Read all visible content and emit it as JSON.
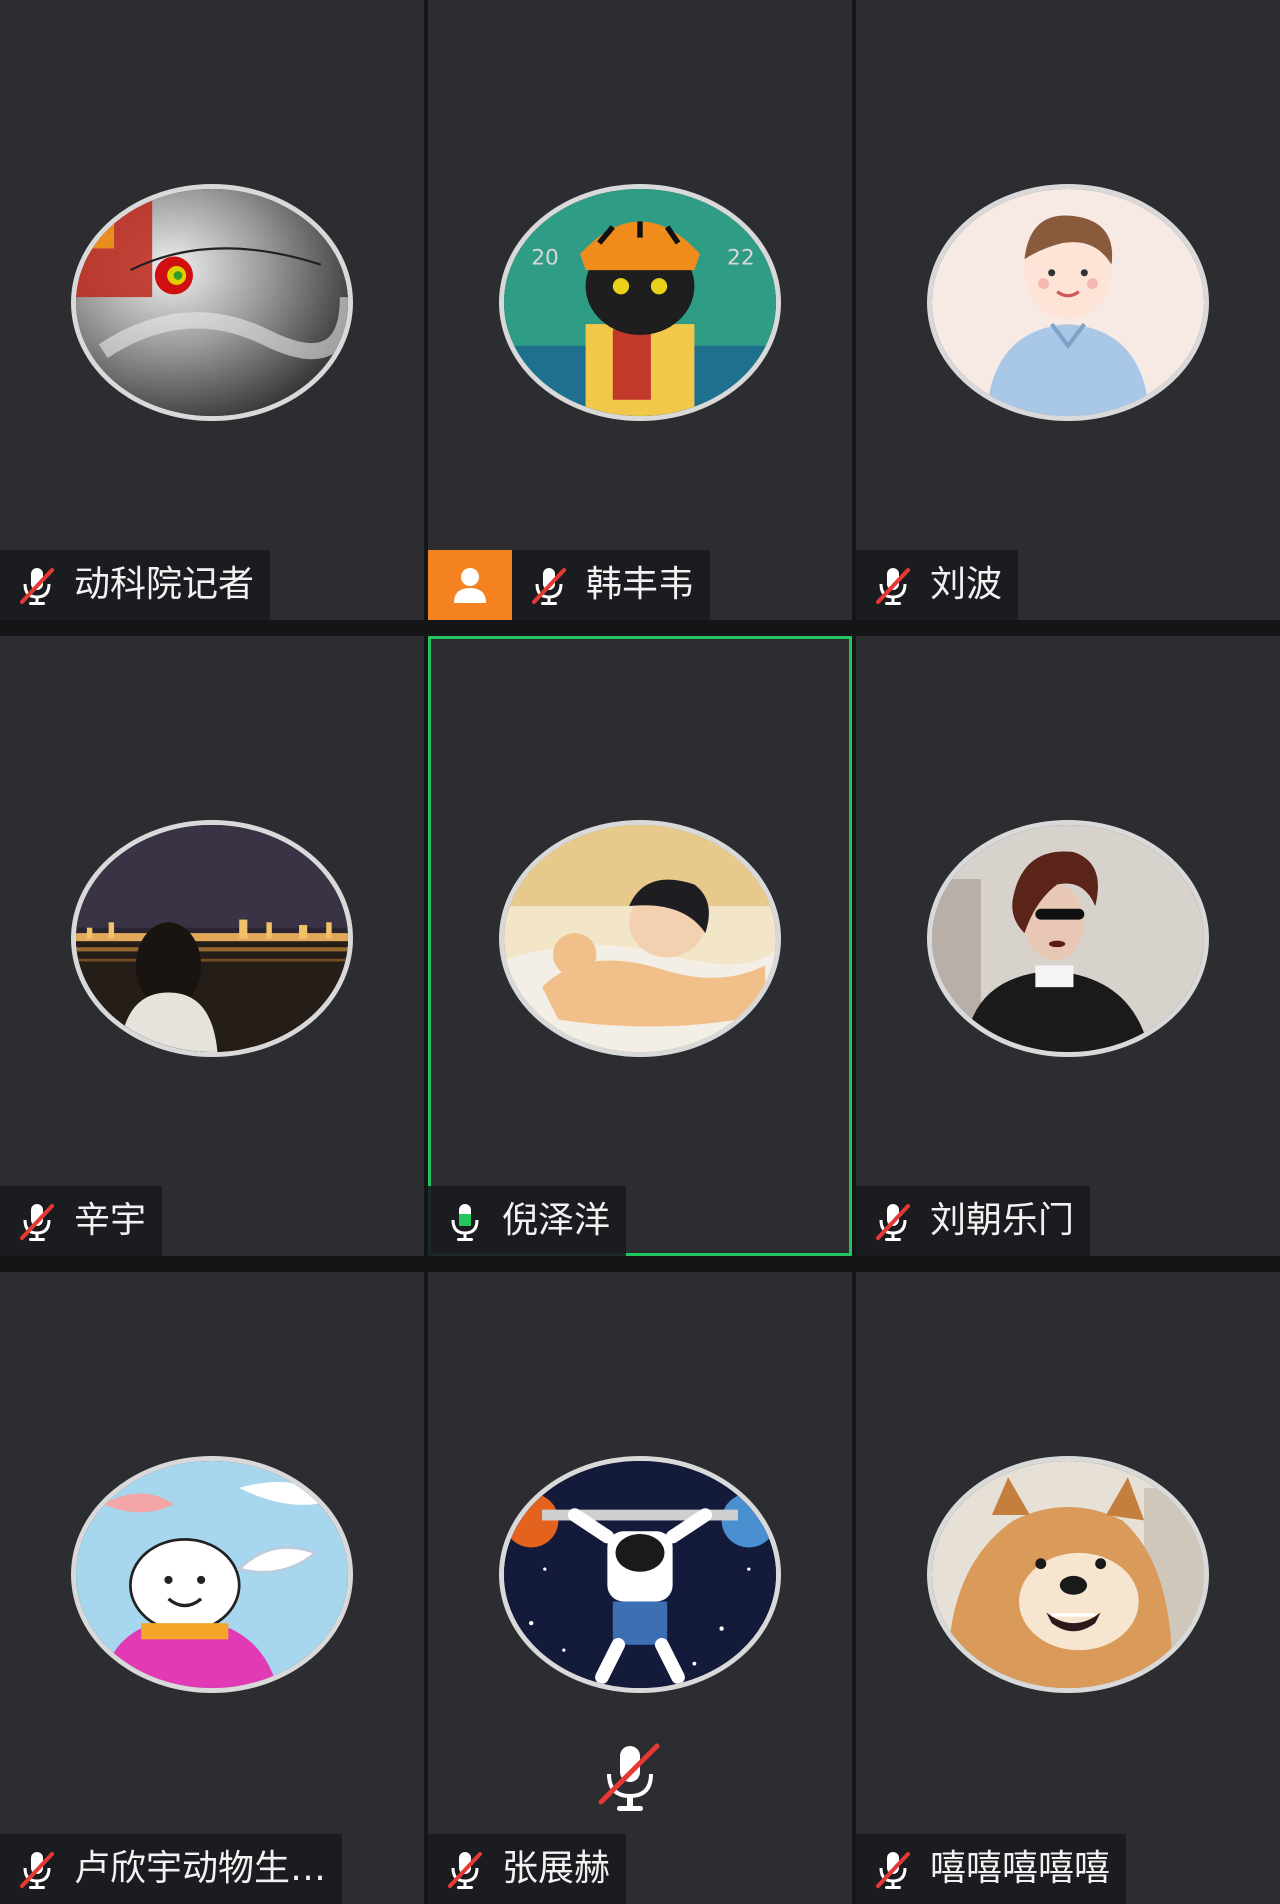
{
  "colors": {
    "tile_bg": "#2b2d31",
    "active_border": "#22c55e",
    "muted_slash": "#e53935",
    "speaking_mic": "#22c55e",
    "host_badge": "#f58220"
  },
  "participants": [
    {
      "name": "动科院记者",
      "mic": "muted",
      "host": false,
      "active": false,
      "avatar": "typhoon-satellite"
    },
    {
      "name": "韩丰韦",
      "mic": "muted",
      "host": true,
      "active": false,
      "avatar": "tiger-hat-cat"
    },
    {
      "name": "刘波",
      "mic": "muted",
      "host": false,
      "active": false,
      "avatar": "cartoon-boy-blue-shirt"
    },
    {
      "name": "辛宇",
      "mic": "muted",
      "host": false,
      "active": false,
      "avatar": "girl-night-river"
    },
    {
      "name": "倪泽洋",
      "mic": "speaking",
      "host": false,
      "active": true,
      "avatar": "boy-sleeping-cat"
    },
    {
      "name": "刘朝乐门",
      "mic": "muted",
      "host": false,
      "active": false,
      "avatar": "woman-sunglasses"
    },
    {
      "name": "卢欣宇动物生…",
      "mic": "muted",
      "host": false,
      "active": false,
      "avatar": "snow-cartoon"
    },
    {
      "name": "张展赫",
      "mic": "muted",
      "host": false,
      "active": false,
      "avatar": "astronaut-barbell"
    },
    {
      "name": "嘻嘻嘻嘻嘻",
      "mic": "muted",
      "host": false,
      "active": false,
      "avatar": "shiba-dog"
    }
  ],
  "self_mic_state": "muted"
}
